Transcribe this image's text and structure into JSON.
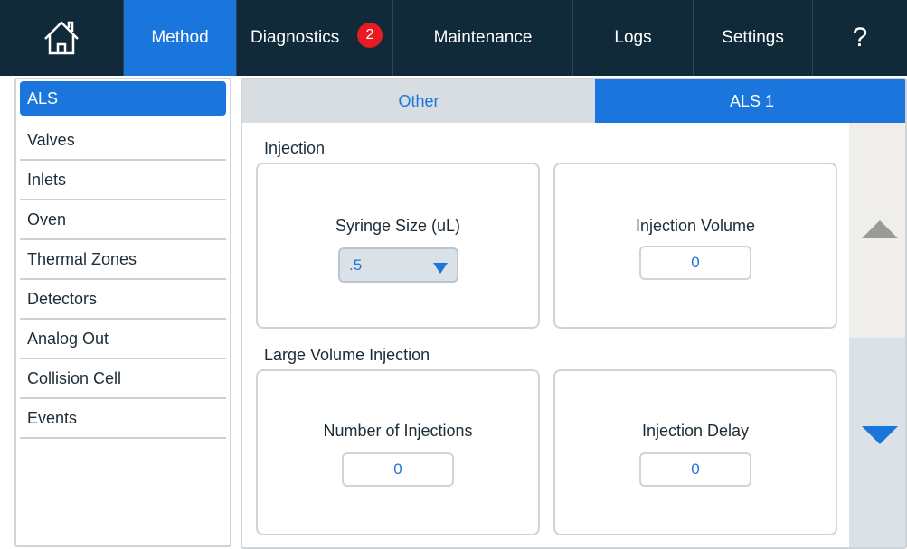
{
  "nav": {
    "home_icon": "home-icon",
    "tabs": [
      "Method",
      "Diagnostics",
      "Maintenance",
      "Logs",
      "Settings"
    ],
    "active_tab": "Method",
    "diagnostics_badge": "2",
    "help": "?"
  },
  "sidebar": {
    "items": [
      "ALS",
      "Valves",
      "Inlets",
      "Oven",
      "Thermal Zones",
      "Detectors",
      "Analog Out",
      "Collision Cell",
      "Events"
    ],
    "active": "ALS"
  },
  "subtabs": {
    "other": "Other",
    "als1": "ALS 1",
    "active": "ALS 1"
  },
  "injection": {
    "section": "Injection",
    "syringe_size_label": "Syringe Size (uL)",
    "syringe_size_value": ".5",
    "injection_volume_label": "Injection Volume",
    "injection_volume_value": "0"
  },
  "large_volume": {
    "section": "Large Volume Injection",
    "num_injections_label": "Number of Injections",
    "num_injections_value": "0",
    "injection_delay_label": "Injection Delay",
    "injection_delay_value": "0"
  },
  "colors": {
    "accent": "#1a75dd",
    "topbar": "#112a39",
    "badge": "#e81b23"
  }
}
